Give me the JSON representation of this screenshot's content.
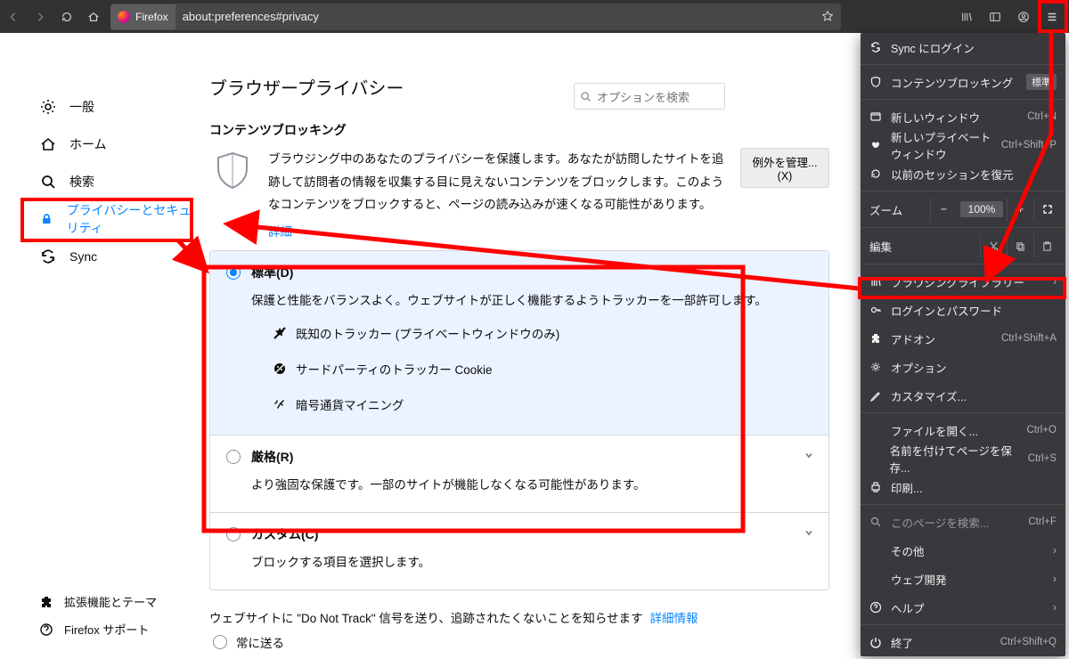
{
  "toolbar": {
    "identity_label": "Firefox",
    "url": "about:preferences#privacy"
  },
  "sidebar": {
    "items": [
      {
        "label": "一般"
      },
      {
        "label": "ホーム"
      },
      {
        "label": "検索"
      },
      {
        "label": "プライバシーとセキュリティ"
      },
      {
        "label": "Sync"
      }
    ],
    "bottom": [
      {
        "label": "拡張機能とテーマ"
      },
      {
        "label": "Firefox サポート"
      }
    ]
  },
  "search": {
    "placeholder": "オプションを検索"
  },
  "page": {
    "title": "ブラウザープライバシー",
    "section_cb": "コンテンツブロッキング",
    "cb_desc": "ブラウジング中のあなたのプライバシーを保護します。あなたが訪問したサイトを追跡して訪問者の情報を収集する目に見えないコンテンツをブロックします。このようなコンテンツをブロックすると、ページの読み込みが速くなる可能性があります。",
    "exceptions_btn": "例外を管理...(X)",
    "detail_link": "詳細",
    "std": {
      "title": "標準(D)",
      "sub": "保護と性能をバランスよく。ウェブサイトが正しく機能するようトラッカーを一部許可します。",
      "items": [
        "既知のトラッカー (プライベートウィンドウのみ)",
        "サードパーティのトラッカー Cookie",
        "暗号通貨マイニング"
      ]
    },
    "strict": {
      "title": "厳格(R)",
      "sub": "より強固な保護です。一部のサイトが機能しなくなる可能性があります。"
    },
    "custom": {
      "title": "カスタム(C)",
      "sub": "ブロックする項目を選択します。"
    },
    "dnt": {
      "text": "ウェブサイトに \"Do Not Track\" 信号を送り、追跡されたくないことを知らせます",
      "more": "詳細情報",
      "opt_always": "常に送る"
    }
  },
  "menu": {
    "sync": "Sync にログイン",
    "content_block": "コンテンツブロッキング",
    "cb_badge": "標準",
    "new_window": "新しいウィンドウ",
    "new_window_sc": "Ctrl+N",
    "new_private": "新しいプライベートウィンドウ",
    "new_private_sc": "Ctrl+Shift+P",
    "restore": "以前のセッションを復元",
    "zoom": "ズーム",
    "zoom_pct": "100%",
    "edit": "編集",
    "library": "ブラウジングライブラリー",
    "logins": "ログインとパスワード",
    "addons": "アドオン",
    "addons_sc": "Ctrl+Shift+A",
    "options": "オプション",
    "customize": "カスタマイズ...",
    "open_file": "ファイルを開く...",
    "open_file_sc": "Ctrl+O",
    "save_as": "名前を付けてページを保存...",
    "save_as_sc": "Ctrl+S",
    "print": "印刷...",
    "find": "このページを検索...",
    "find_sc": "Ctrl+F",
    "more": "その他",
    "webdev": "ウェブ開発",
    "help": "ヘルプ",
    "quit": "終了",
    "quit_sc": "Ctrl+Shift+Q"
  }
}
